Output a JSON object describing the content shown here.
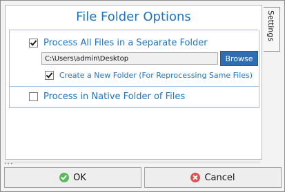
{
  "dialog": {
    "title": "File Folder Options",
    "side_tab_label": "Settings"
  },
  "separate_folder": {
    "checkbox_label": "Process All Files in a Separate Folder",
    "checked": true,
    "path_value": "C:\\Users\\admin\\Desktop",
    "browse_label": "Browse",
    "create_folder_label": "Create a New Folder (For Reprocessing Same Files)",
    "create_folder_checked": true
  },
  "native_folder": {
    "checkbox_label": "Process in Native Folder of Files",
    "checked": false
  },
  "footer": {
    "ok_label": "OK",
    "cancel_label": "Cancel"
  },
  "colors": {
    "accent": "#1e73be",
    "browse_bg": "#2e6fb3",
    "ok_icon": "#5cb85c",
    "cancel_icon": "#d9534f"
  }
}
